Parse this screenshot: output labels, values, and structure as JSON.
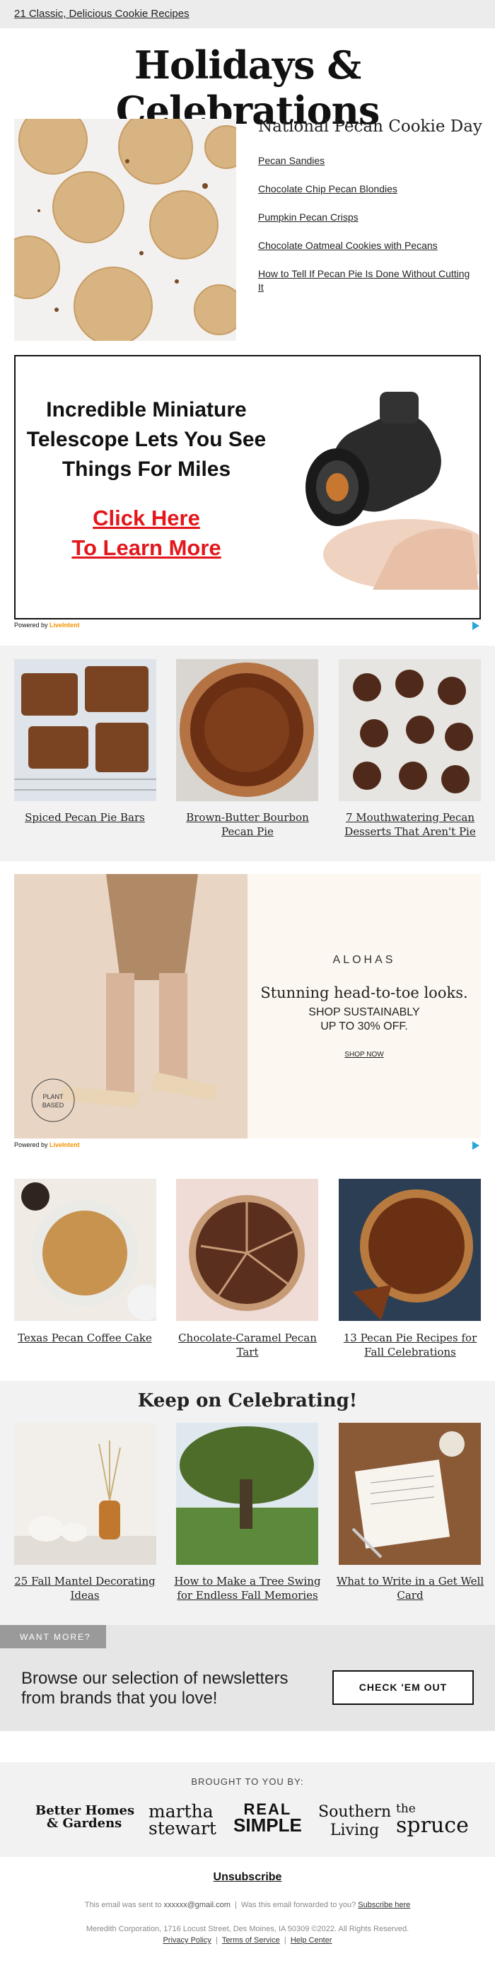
{
  "topbar": {
    "link": "21 Classic, Delicious Cookie Recipes"
  },
  "hero": {
    "title": "Holidays & Celebrations"
  },
  "feature": {
    "heading": "National Pecan Cookie Day",
    "links": [
      "Pecan Sandies",
      "Chocolate Chip Pecan Blondies",
      "Pumpkin Pecan Crisps",
      "Chocolate Oatmeal Cookies with Pecans",
      "How to Tell If Pecan Pie Is Done Without Cutting It"
    ]
  },
  "ad1": {
    "text": "Incredible Miniature Telescope Lets You See Things For Miles",
    "cta_line1": "Click Here",
    "cta_line2": "To Learn More",
    "powered_prefix": "Powered by",
    "powered_brand": "LiveIntent"
  },
  "cards1": [
    {
      "caption": "Spiced Pecan Pie Bars"
    },
    {
      "caption": "Brown-Butter Bourbon Pecan Pie"
    },
    {
      "caption": "7 Mouthwatering Pecan Desserts That Aren't Pie"
    }
  ],
  "ad2": {
    "brand": "ALOHAS",
    "headline": "Stunning head-to-toe looks.",
    "sub1": "SHOP SUSTAINABLY",
    "sub2": "UP TO 30% OFF.",
    "shop": "SHOP NOW",
    "badge1": "PLANT",
    "badge2": "BASED",
    "powered_prefix": "Powered by",
    "powered_brand": "LiveIntent"
  },
  "cards2": [
    {
      "caption": "Texas Pecan Coffee Cake"
    },
    {
      "caption": "Chocolate-Caramel Pecan Tart"
    },
    {
      "caption": "13 Pecan Pie Recipes for Fall Celebrations"
    }
  ],
  "keep": {
    "title": "Keep on Celebrating!",
    "cards": [
      {
        "caption": "25 Fall Mantel Decorating Ideas"
      },
      {
        "caption": "How to Make a Tree Swing for Endless Fall Memories"
      },
      {
        "caption": "What to Write in a Get Well Card"
      }
    ]
  },
  "want": {
    "tab": "WANT MORE?",
    "text": "Browse our selection of newsletters from brands that you love!",
    "button": "CHECK 'EM OUT"
  },
  "brands": {
    "heading": "BROUGHT TO YOU BY:",
    "bhg1": "Better Homes",
    "bhg2": "& Gardens",
    "martha1": "martha",
    "martha2": "stewart",
    "real": "REAL",
    "simple": "SIMPLE",
    "southern": "Southern",
    "living": "Living",
    "the": "the",
    "spruce": "spruce"
  },
  "footer": {
    "unsubscribe": "Unsubscribe",
    "sent_prefix": "This email was sent to",
    "email": "xxxxxx@gmail.com",
    "forwarded": "Was this email forwarded to you?",
    "subscribe": "Subscribe here",
    "address": "Meredith Corporation, 1716 Locust Street, Des Moines, IA 50309 ©2022. All Rights Reserved.",
    "privacy": "Privacy Policy",
    "terms": "Terms of Service",
    "help": "Help Center"
  }
}
